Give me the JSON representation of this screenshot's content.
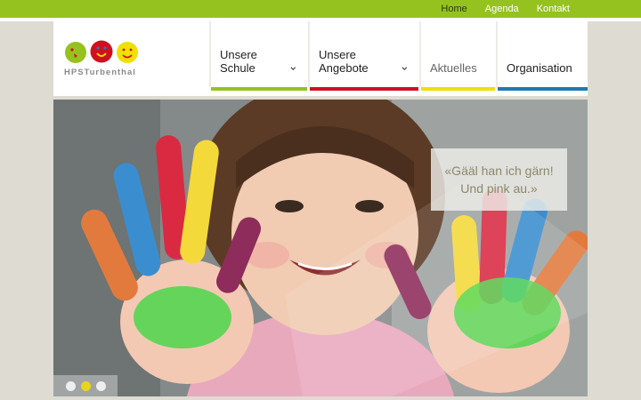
{
  "colors": {
    "accent_green": "#96c21f",
    "accent_red": "#d0101e",
    "accent_yellow": "#f0df00",
    "accent_blue": "#1f79b8",
    "page_bg": "#dedcd2"
  },
  "util_nav": [
    {
      "label": "Home"
    },
    {
      "label": "Agenda"
    },
    {
      "label": "Kontakt"
    }
  ],
  "logo": {
    "text": "HPSTurbenthal"
  },
  "main_nav": [
    {
      "label": "Unsere Schule",
      "color": "#96c21f"
    },
    {
      "label": "Unsere Angebote",
      "color": "#d0101e"
    },
    {
      "label": "Aktuelles",
      "color": "#f0df00"
    },
    {
      "label": "Organisation",
      "color": "#1f79b8"
    }
  ],
  "hero": {
    "quote_line1": "«Gääl han ich gärn!",
    "quote_line2": "Und pink au.»",
    "slides_total": 3,
    "active_slide": 2
  }
}
